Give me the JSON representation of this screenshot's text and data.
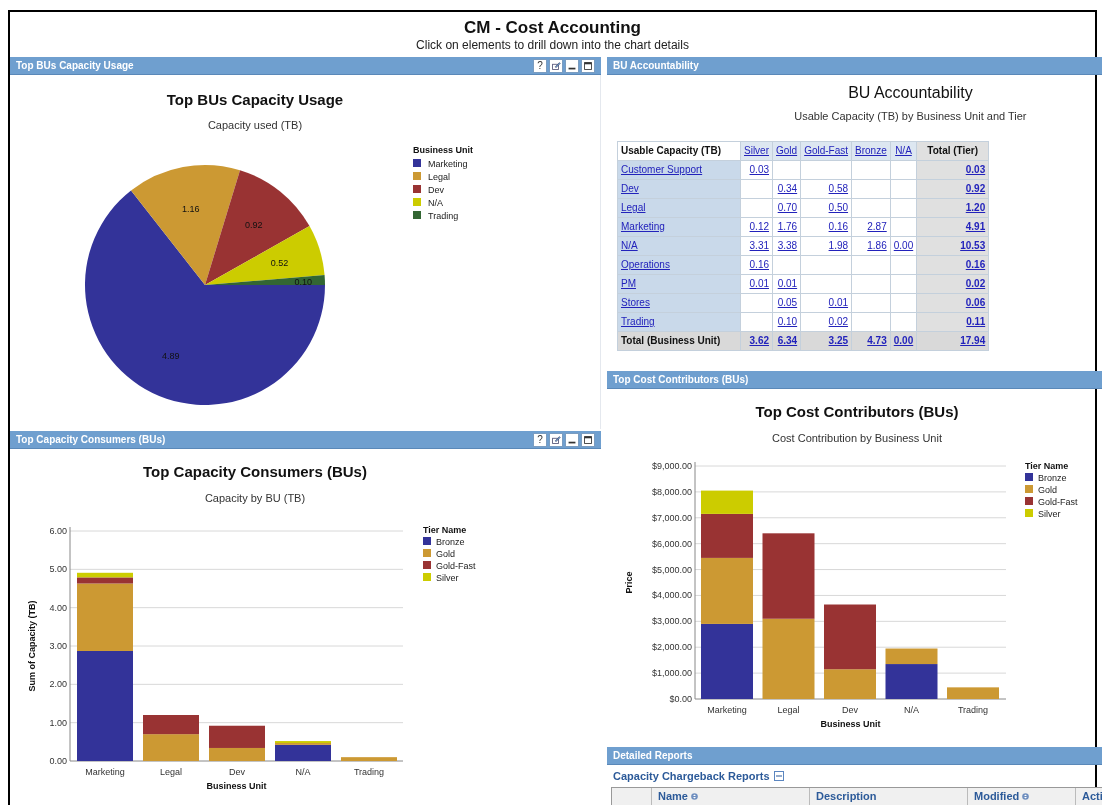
{
  "page": {
    "title": "CM - Cost Accounting",
    "subtitle": "Click on elements to drill down into the chart details"
  },
  "capacity_usage": {
    "header": "Top BUs Capacity Usage",
    "help_label": "?",
    "subtitle": "Capacity used (TB)",
    "chart_data": {
      "type": "pie",
      "title": "Top BUs Capacity Usage",
      "categories": [
        "Marketing",
        "Legal",
        "Dev",
        "N/A",
        "Trading"
      ],
      "values": [
        4.89,
        1.16,
        0.92,
        0.52,
        0.1
      ],
      "colors": [
        "#333399",
        "#cc9933",
        "#993333",
        "#cccc00",
        "#336633"
      ],
      "value_labels": [
        "4.89",
        "1.16",
        "0.92",
        "0.52",
        "0.10"
      ],
      "legend": {
        "title": "Business Unit"
      }
    }
  },
  "capacity_consumers": {
    "header": "Top Capacity Consumers (BUs)",
    "help_label": "?",
    "subtitle": "Capacity by BU (TB)",
    "chart_data": {
      "type": "bar",
      "title": "Top Capacity Consumers (BUs)",
      "grid": true,
      "legend": {
        "title": "Tier Name"
      },
      "xlabel": "Business Unit",
      "ylabel": "Sum of Capacity (TB)",
      "categories": [
        "Marketing",
        "Legal",
        "Dev",
        "N/A",
        "Trading"
      ],
      "stacked": true,
      "ylim": [
        0,
        6
      ],
      "yticks": [
        {
          "value": 0,
          "label": "0.00"
        },
        {
          "value": 1,
          "label": "1.00"
        },
        {
          "value": 2,
          "label": "2.00"
        },
        {
          "value": 3,
          "label": "3.00"
        },
        {
          "value": 4,
          "label": "4.00"
        },
        {
          "value": 5,
          "label": "5.00"
        },
        {
          "value": 6,
          "label": "6.00"
        }
      ],
      "series": [
        {
          "name": "Bronze",
          "color": "#333399",
          "values": [
            2.87,
            null,
            null,
            0.42,
            null
          ]
        },
        {
          "name": "Gold",
          "color": "#cc9933",
          "values": [
            1.76,
            0.7,
            0.34,
            0.05,
            0.1
          ]
        },
        {
          "name": "Gold-Fast",
          "color": "#993333",
          "values": [
            0.16,
            0.5,
            0.58,
            null,
            null
          ]
        },
        {
          "name": "Silver",
          "color": "#cccc00",
          "values": [
            0.12,
            null,
            null,
            0.05,
            null
          ]
        }
      ]
    }
  },
  "bu_accountability": {
    "header": "BU Accountability",
    "title": "BU Accountability",
    "subtitle": "Usable Capacity (TB) by Business Unit and Tier",
    "table": {
      "corner": "Usable Capacity (TB)",
      "columns": [
        "Silver",
        "Gold",
        "Gold-Fast",
        "Bronze",
        "N/A"
      ],
      "total_column": "Total (Tier)",
      "rows": [
        {
          "label": "Customer Support",
          "cells": [
            "0.03",
            null,
            null,
            null,
            null
          ],
          "total": "0.03"
        },
        {
          "label": "Dev",
          "cells": [
            null,
            "0.34",
            "0.58",
            null,
            null
          ],
          "total": "0.92"
        },
        {
          "label": "Legal",
          "cells": [
            null,
            "0.70",
            "0.50",
            null,
            null
          ],
          "total": "1.20"
        },
        {
          "label": "Marketing",
          "cells": [
            "0.12",
            "1.76",
            "0.16",
            "2.87",
            null
          ],
          "total": "4.91"
        },
        {
          "label": "N/A",
          "cells": [
            "3.31",
            "3.38",
            "1.98",
            "1.86",
            "0.00"
          ],
          "total": "10.53"
        },
        {
          "label": "Operations",
          "cells": [
            "0.16",
            null,
            null,
            null,
            null
          ],
          "total": "0.16"
        },
        {
          "label": "PM",
          "cells": [
            "0.01",
            "0.01",
            null,
            null,
            null
          ],
          "total": "0.02"
        },
        {
          "label": "Stores",
          "cells": [
            null,
            "0.05",
            "0.01",
            null,
            null
          ],
          "total": "0.06"
        },
        {
          "label": "Trading",
          "cells": [
            null,
            "0.10",
            "0.02",
            null,
            null
          ],
          "total": "0.11"
        }
      ],
      "total_row": {
        "label": "Total (Business Unit)",
        "cells": [
          "3.62",
          "6.34",
          "3.25",
          "4.73",
          "0.00"
        ],
        "total": "17.94"
      }
    }
  },
  "cost_contributors": {
    "header": "Top Cost Contributors (BUs)",
    "subtitle": "Cost Contribution by Business Unit",
    "chart_data": {
      "type": "bar",
      "title": "Top Cost Contributors (BUs)",
      "grid": true,
      "legend": {
        "title": "Tier Name"
      },
      "xlabel": "Business Unit",
      "ylabel": "Price",
      "categories": [
        "Marketing",
        "Legal",
        "Dev",
        "N/A",
        "Trading"
      ],
      "stacked": true,
      "ylim": [
        0,
        9000
      ],
      "yticks": [
        {
          "value": 0,
          "label": "$0.00"
        },
        {
          "value": 1000,
          "label": "$1,000.00"
        },
        {
          "value": 2000,
          "label": "$2,000.00"
        },
        {
          "value": 3000,
          "label": "$3,000.00"
        },
        {
          "value": 4000,
          "label": "$4,000.00"
        },
        {
          "value": 5000,
          "label": "$5,000.00"
        },
        {
          "value": 6000,
          "label": "$6,000.00"
        },
        {
          "value": 7000,
          "label": "$7,000.00"
        },
        {
          "value": 8000,
          "label": "$8,000.00"
        },
        {
          "value": 9000,
          "label": "$9,000.00"
        }
      ],
      "series": [
        {
          "name": "Bronze",
          "color": "#333399",
          "values": [
            2900,
            null,
            null,
            1350,
            null
          ]
        },
        {
          "name": "Gold",
          "color": "#cc9933",
          "values": [
            2550,
            3100,
            1150,
            600,
            450
          ]
        },
        {
          "name": "Gold-Fast",
          "color": "#993333",
          "values": [
            1700,
            3300,
            2500,
            null,
            null
          ]
        },
        {
          "name": "Silver",
          "color": "#cccc00",
          "values": [
            900,
            null,
            null,
            null,
            null
          ]
        }
      ]
    }
  },
  "detailed_reports": {
    "header": "Detailed Reports",
    "section": "Capacity Chargeback Reports",
    "expanded": true,
    "columns": [
      {
        "label": "Name",
        "sortable": true
      },
      {
        "label": "Description",
        "sortable": false
      },
      {
        "label": "Modified",
        "sortable": true
      },
      {
        "label": "Acti"
      }
    ]
  }
}
